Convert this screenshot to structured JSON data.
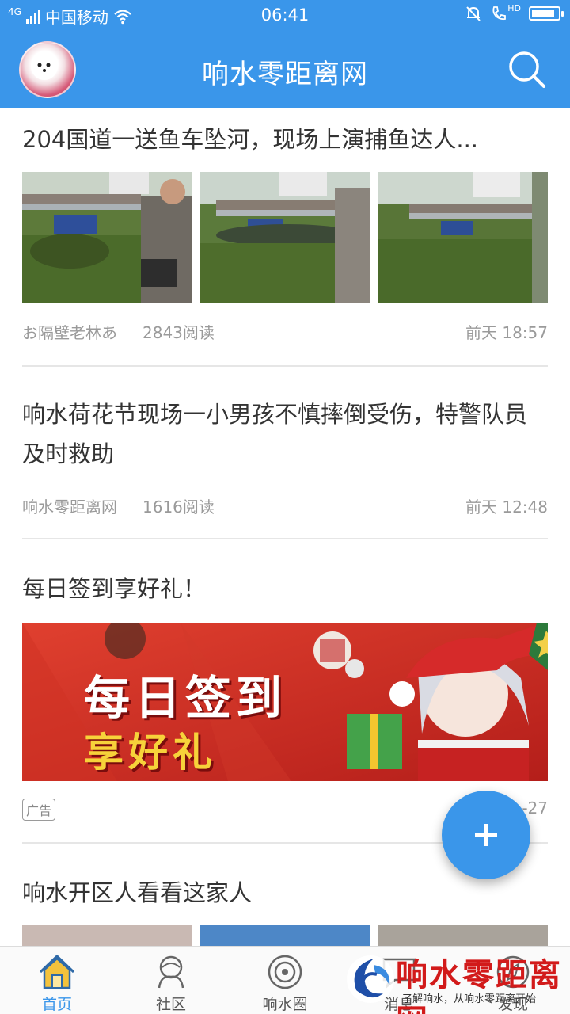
{
  "status_bar": {
    "network_type": "4G",
    "carrier": "中国移动",
    "time": "06:41",
    "hd_label": "HD",
    "battery_level": 0.85
  },
  "header": {
    "title": "响水零距离网",
    "avatar_icon": "avatar-image",
    "search_icon": "search-icon"
  },
  "feed": {
    "articles": [
      {
        "title": "204国道一送鱼车坠河，现场上演捕鱼达人...",
        "source": "お隔壁老林あ",
        "reads": "2843阅读",
        "time": "前天 18:57",
        "thumbnail_count": 3
      },
      {
        "title": "响水荷花节现场一小男孩不慎摔倒受伤，特警队员及时救助",
        "source": "响水零距离网",
        "reads": "1616阅读",
        "time": "前天 12:48"
      },
      {
        "title": "每日签到享好礼！",
        "ad_tag": "广告",
        "time_partial": "-27",
        "banner": {
          "line1": "每日签到",
          "line2": "享好礼"
        }
      },
      {
        "title": "响水开区人看看这家人"
      }
    ]
  },
  "fab": {
    "icon": "plus-icon"
  },
  "bottom_nav": {
    "items": [
      {
        "label": "首页",
        "icon": "home-icon",
        "active": true
      },
      {
        "label": "社区",
        "icon": "community-icon",
        "active": false
      },
      {
        "label": "响水圈",
        "icon": "circle-icon",
        "active": false
      },
      {
        "label": "消息",
        "icon": "message-icon",
        "active": false
      },
      {
        "label": "发现",
        "icon": "discover-icon",
        "active": false
      }
    ]
  },
  "watermark": {
    "title": "响水零距离网",
    "slogan": "了解响水，从响水零距离开始"
  },
  "colors": {
    "primary": "#3a96ea",
    "watermark_red": "#d21a1a",
    "meta_gray": "#9a9a9a"
  }
}
